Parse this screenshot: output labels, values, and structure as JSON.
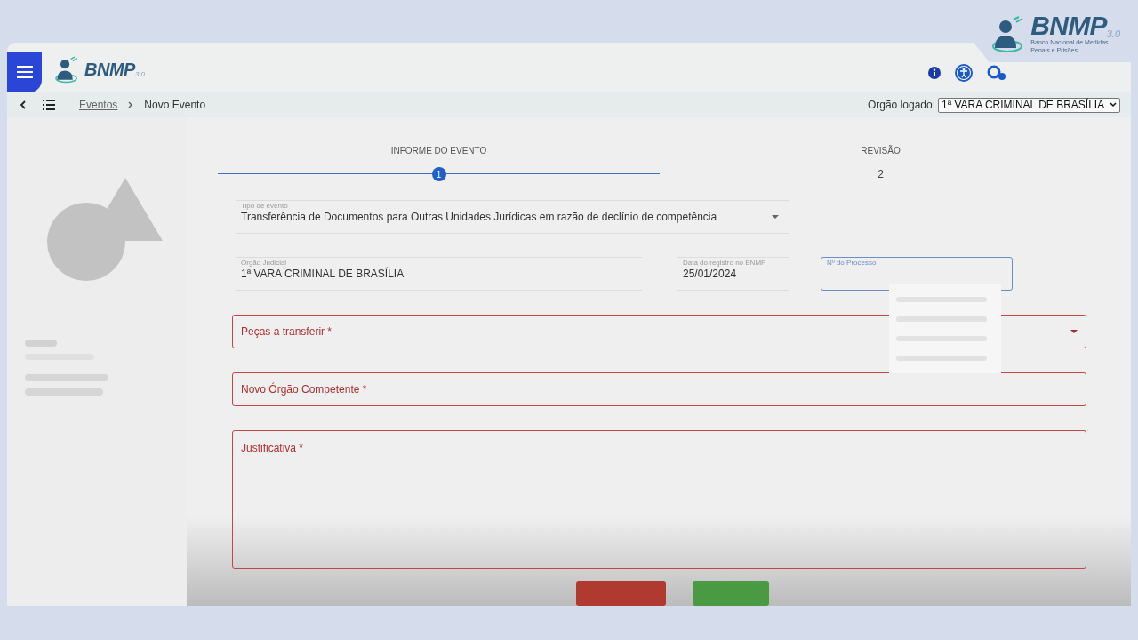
{
  "corner_logo": {
    "name": "BNMP",
    "version": "3.0",
    "subtitle": "Banco Nacional de Medidas Penais e Prisões"
  },
  "header": {
    "logo": {
      "name": "BNMP",
      "version": "3.0"
    }
  },
  "breadcrumb": [
    {
      "label": "Eventos",
      "kind": "link"
    },
    {
      "label": "Novo Evento",
      "kind": "current"
    }
  ],
  "orgao": {
    "label": "Orgão logado:",
    "value": "1ª VARA CRIMINAL DE BRASÍLIA"
  },
  "steps": [
    {
      "label": "INFORME DO EVENTO",
      "number": "1",
      "selected": true
    },
    {
      "label": "REVISÃO",
      "number": "2",
      "selected": false
    }
  ],
  "fields": [
    {
      "kind": "select",
      "label": "Tipo de evento",
      "value": "Transferência de Documentos para Outras Unidades Jurídicas em razão de declínio de competência"
    },
    {
      "kind": "text",
      "label": "Orgão Judicial",
      "value": "1ª VARA CRIMINAL DE BRASÍLIA"
    },
    {
      "kind": "text",
      "label": "Data do registro no BNMP",
      "value": "25/01/2024"
    },
    {
      "kind": "outlined",
      "label": "Nº do Processo",
      "focused": true
    },
    {
      "kind": "required_select",
      "label": "Peças a transferir *",
      "error": true
    },
    {
      "kind": "required_text",
      "label": "Novo Órgão Competente *",
      "error": true
    },
    {
      "kind": "textarea",
      "label": "Justificativa *",
      "error": true
    }
  ]
}
